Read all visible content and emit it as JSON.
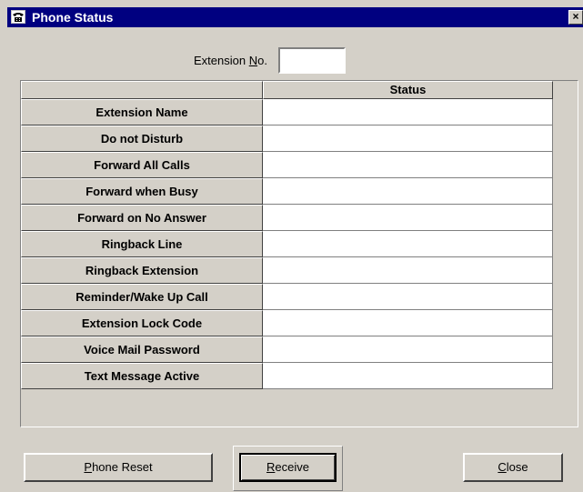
{
  "window": {
    "title": "Phone Status",
    "icon": "telephone-icon",
    "close_label": "×"
  },
  "extension": {
    "label_prefix": "Extension ",
    "label_accel": "N",
    "label_suffix": "o.",
    "value": ""
  },
  "table": {
    "corner_header": "",
    "status_header": "Status",
    "rows": [
      {
        "label": "Extension Name",
        "status": ""
      },
      {
        "label": "Do not Disturb",
        "status": ""
      },
      {
        "label": "Forward All Calls",
        "status": ""
      },
      {
        "label": "Forward when Busy",
        "status": ""
      },
      {
        "label": "Forward on No Answer",
        "status": ""
      },
      {
        "label": "Ringback Line",
        "status": ""
      },
      {
        "label": "Ringback Extension",
        "status": ""
      },
      {
        "label": "Reminder/Wake Up Call",
        "status": ""
      },
      {
        "label": "Extension Lock Code",
        "status": ""
      },
      {
        "label": "Voice Mail Password",
        "status": ""
      },
      {
        "label": "Text Message Active",
        "status": ""
      }
    ]
  },
  "buttons": {
    "phone_reset": {
      "accel": "P",
      "rest": "hone Reset"
    },
    "receive": {
      "accel": "R",
      "rest": "eceive"
    },
    "close": {
      "accel": "C",
      "rest": "lose"
    }
  }
}
